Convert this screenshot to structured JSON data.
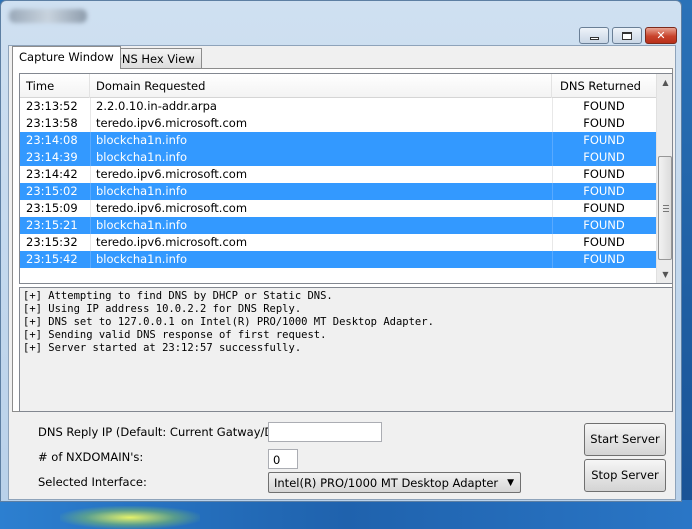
{
  "window": {
    "title_redacted": true,
    "minimize_label": "",
    "close_label": "✕"
  },
  "tabs": [
    {
      "label": "Capture Window",
      "active": true
    },
    {
      "label": "DNS Hex View",
      "active": false
    }
  ],
  "table": {
    "columns": [
      "Time",
      "Domain Requested",
      "DNS Returned"
    ],
    "rows": [
      {
        "time": "23:13:52",
        "domain": "2.2.0.10.in-addr.arpa",
        "status": "FOUND",
        "selected": false
      },
      {
        "time": "23:13:58",
        "domain": "teredo.ipv6.microsoft.com",
        "status": "FOUND",
        "selected": false
      },
      {
        "time": "23:14:08",
        "domain": "blockcha1n.info",
        "status": "FOUND",
        "selected": true
      },
      {
        "time": "23:14:39",
        "domain": "blockcha1n.info",
        "status": "FOUND",
        "selected": true
      },
      {
        "time": "23:14:42",
        "domain": "teredo.ipv6.microsoft.com",
        "status": "FOUND",
        "selected": false
      },
      {
        "time": "23:15:02",
        "domain": "blockcha1n.info",
        "status": "FOUND",
        "selected": true
      },
      {
        "time": "23:15:09",
        "domain": "teredo.ipv6.microsoft.com",
        "status": "FOUND",
        "selected": false
      },
      {
        "time": "23:15:21",
        "domain": "blockcha1n.info",
        "status": "FOUND",
        "selected": true
      },
      {
        "time": "23:15:32",
        "domain": "teredo.ipv6.microsoft.com",
        "status": "FOUND",
        "selected": false
      },
      {
        "time": "23:15:42",
        "domain": "blockcha1n.info",
        "status": "FOUND",
        "selected": true
      }
    ]
  },
  "log": [
    "[+] Attempting to find DNS by DHCP or Static DNS.",
    "[+] Using IP address 10.0.2.2 for DNS Reply.",
    "[+] DNS set to 127.0.0.1 on Intel(R) PRO/1000 MT Desktop Adapter.",
    "[+] Sending valid DNS response of first request.",
    "[+] Server started at 23:12:57 successfully."
  ],
  "form": {
    "dns_reply_label": "DNS Reply IP (Default: Current Gatway/DNS):",
    "dns_reply_value": "",
    "nxdomain_label": "# of NXDOMAIN's:",
    "nxdomain_value": "0",
    "interface_label": "Selected Interface:",
    "interface_value": "Intel(R) PRO/1000 MT Desktop Adapter"
  },
  "buttons": {
    "start": "Start Server",
    "stop": "Stop Server"
  },
  "colors": {
    "selection": "#3399ff",
    "close_button": "#c8432c"
  }
}
